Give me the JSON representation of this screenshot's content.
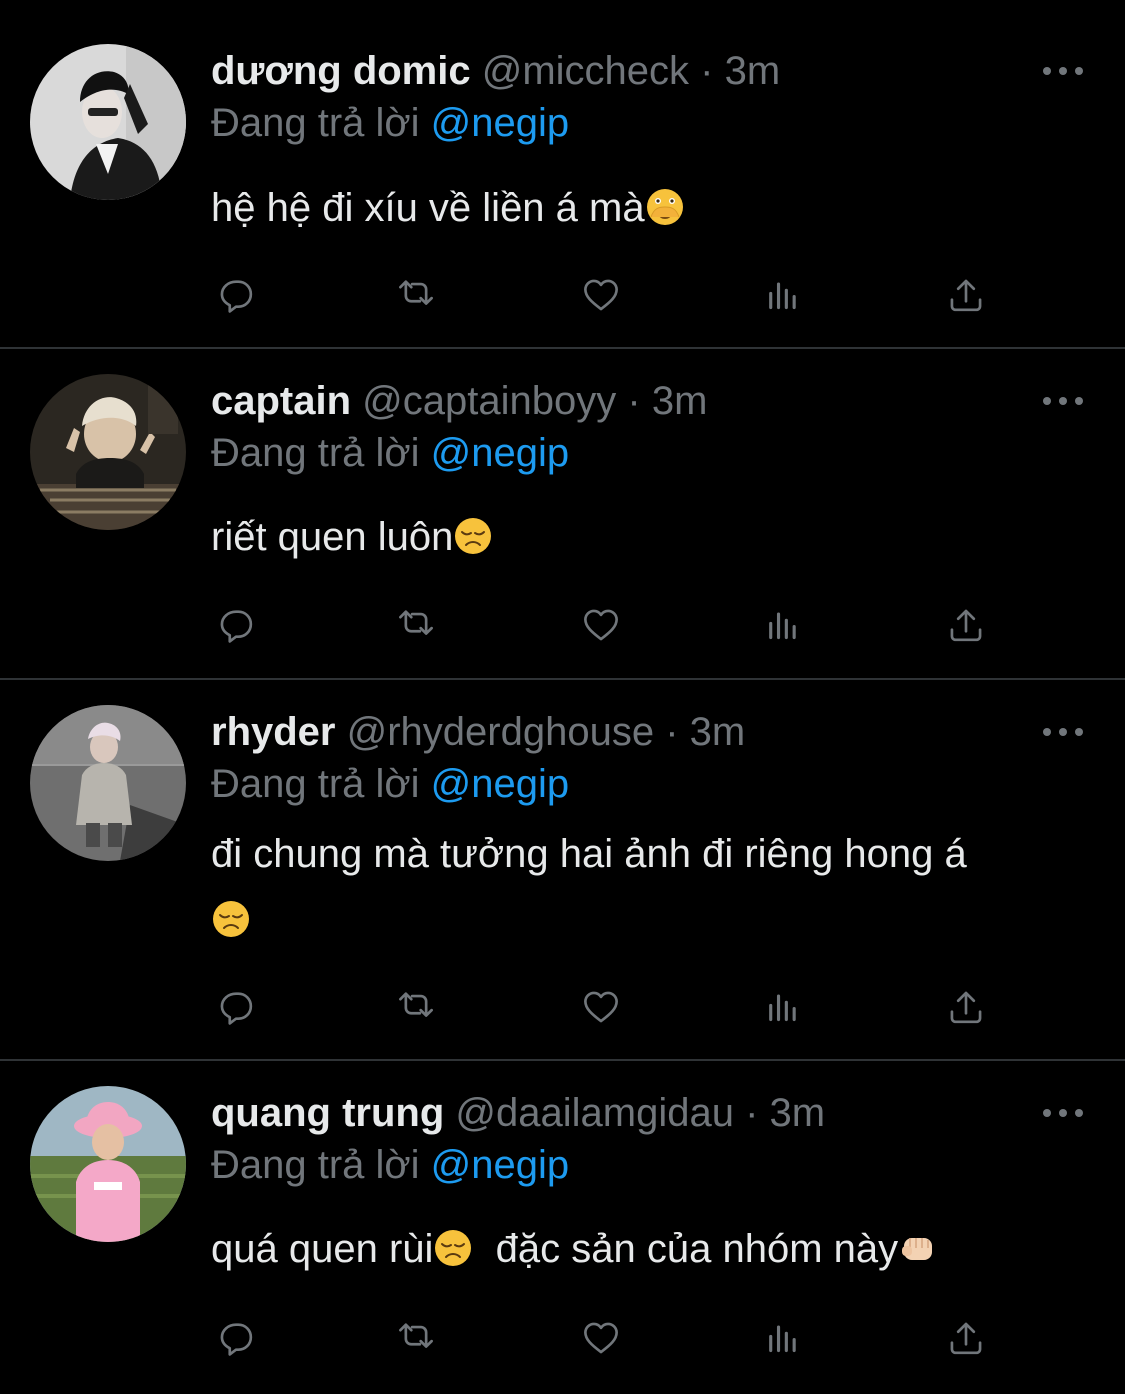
{
  "reply_prefix": "Đang trả lời",
  "icons": {
    "more": "more-horizontal-icon",
    "reply": "reply-icon",
    "retweet": "retweet-icon",
    "like": "heart-icon",
    "views": "views-chart-icon",
    "share": "share-icon"
  },
  "colors": {
    "background": "#000000",
    "text": "#e7e9ea",
    "muted": "#71767b",
    "link": "#1d9bf0",
    "divider": "#2f3336"
  },
  "tweets": [
    {
      "name": "dương domic",
      "handle": "@miccheck",
      "dot": "·",
      "time": "3m",
      "reply_to": "@negip",
      "text": "hệ hệ đi xíu về liền á mà",
      "emoji": "face-with-open-eyes-and-hand-over-mouth"
    },
    {
      "name": "captain",
      "handle": "@captainboyy",
      "dot": "·",
      "time": "3m",
      "reply_to": "@negip",
      "text": "riết quen luôn",
      "emoji": "disappointed-face"
    },
    {
      "name": "rhyder",
      "handle": "@rhyderdghouse",
      "dot": "·",
      "time": "3m",
      "reply_to": "@negip",
      "text": "đi chung mà tưởng hai ảnh đi riêng hong á",
      "emoji": "disappointed-face"
    },
    {
      "name": "quang trung",
      "handle": "@daailamgidau",
      "dot": "·",
      "time": "3m",
      "reply_to": "@negip",
      "text_a": "quá quen rùi",
      "emoji_a": "disappointed-face",
      "text_b": "  đặc sản của nhóm này",
      "emoji_b": "oncoming-fist"
    }
  ]
}
